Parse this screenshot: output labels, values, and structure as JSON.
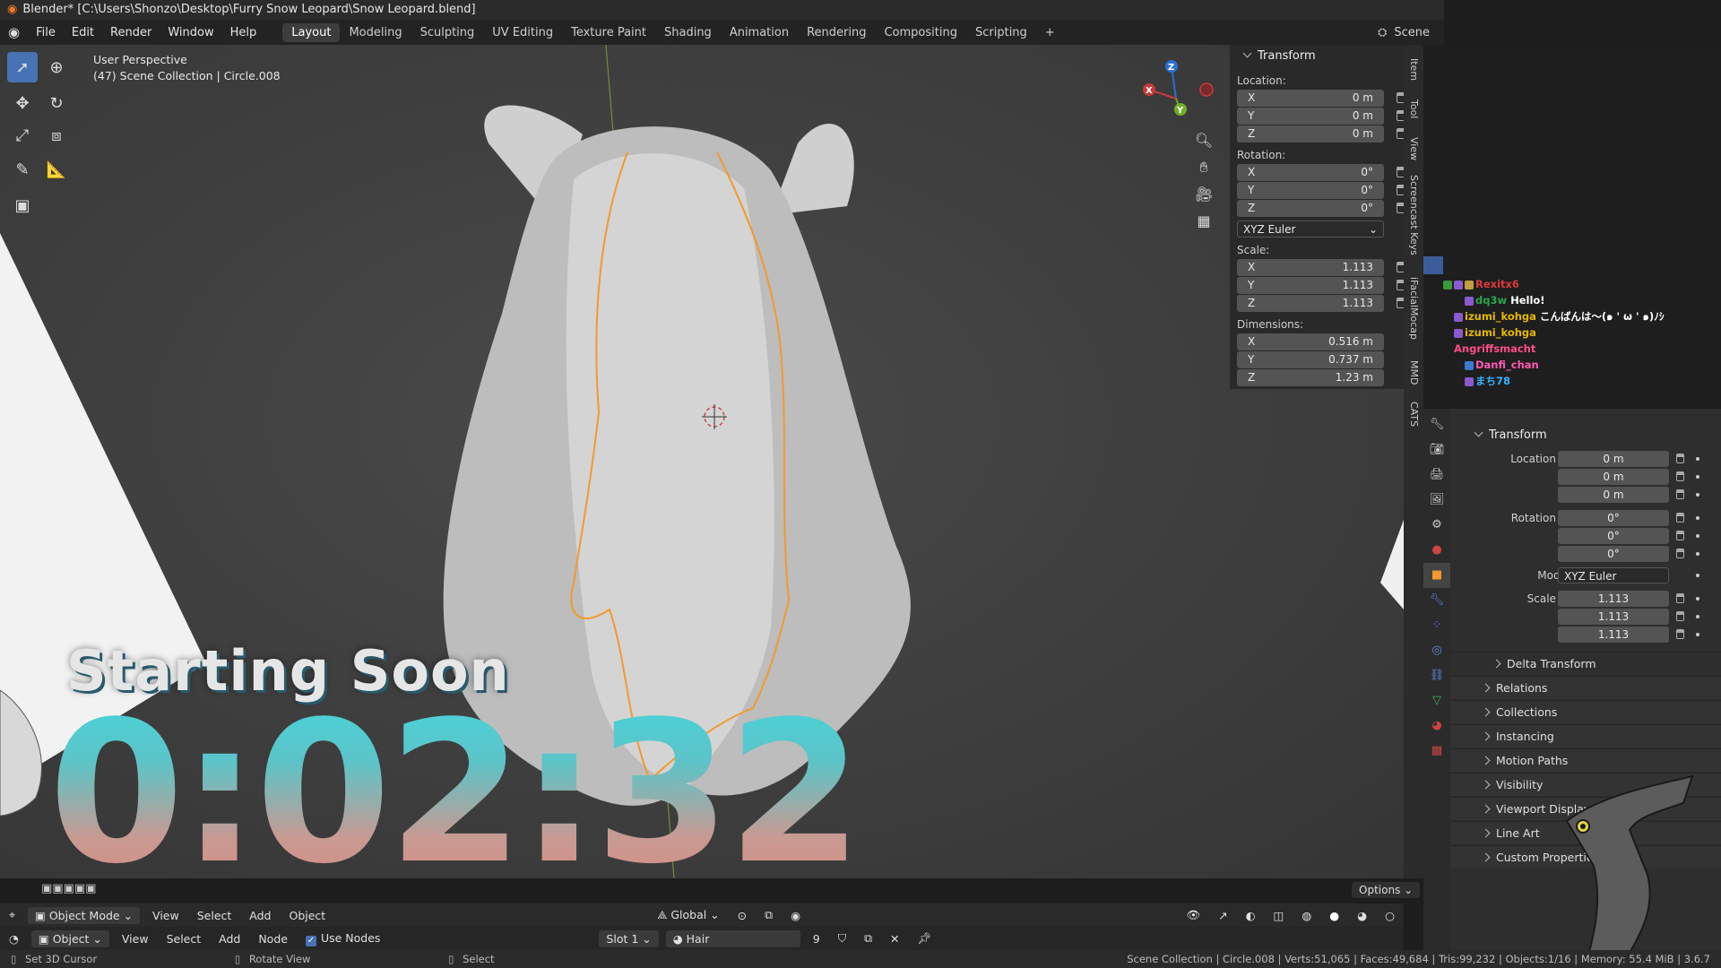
{
  "window": {
    "title": "Blender* [C:\\Users\\Shonzo\\Desktop\\Furry Snow Leopard\\Snow Leopard.blend]"
  },
  "menu": [
    "File",
    "Edit",
    "Render",
    "Window",
    "Help"
  ],
  "workspaces": {
    "active": "Layout",
    "tabs": [
      "Layout",
      "Modeling",
      "Sculpting",
      "UV Editing",
      "Texture Paint",
      "Shading",
      "Animation",
      "Rendering",
      "Compositing",
      "Scripting"
    ],
    "add": "+"
  },
  "scene": {
    "name": "Scene"
  },
  "viewport": {
    "view_name": "User Perspective",
    "collection_info": "(47) Scene Collection | Circle.008",
    "gizmo": {
      "x": "X",
      "y": "Y",
      "z": "Z"
    }
  },
  "npanel": {
    "header": "Transform",
    "location_label": "Location:",
    "location": [
      {
        "k": "X",
        "v": "0 m"
      },
      {
        "k": "Y",
        "v": "0 m"
      },
      {
        "k": "Z",
        "v": "0 m"
      }
    ],
    "rotation_label": "Rotation:",
    "rotation": [
      {
        "k": "X",
        "v": "0°"
      },
      {
        "k": "Y",
        "v": "0°"
      },
      {
        "k": "Z",
        "v": "0°"
      }
    ],
    "rotation_mode": "XYZ Euler",
    "scale_label": "Scale:",
    "scale": [
      {
        "k": "X",
        "v": "1.113"
      },
      {
        "k": "Y",
        "v": "1.113"
      },
      {
        "k": "Z",
        "v": "1.113"
      }
    ],
    "dimensions_label": "Dimensions:",
    "dimensions": [
      {
        "k": "X",
        "v": "0.516 m"
      },
      {
        "k": "Y",
        "v": "0.737 m"
      },
      {
        "k": "Z",
        "v": "1.23 m"
      }
    ]
  },
  "side_tabs": [
    "Item",
    "Tool",
    "View",
    "Screencast Keys",
    "iFacialMocap",
    "MMD",
    "CATS"
  ],
  "chat": [
    {
      "user": "Rexitx6",
      "color": "#e03a3a",
      "msg": ""
    },
    {
      "user": "dq3w",
      "color": "#2aa84a",
      "msg": "Hello!"
    },
    {
      "user": "izumi_kohga",
      "color": "#e6b800",
      "msg": "こんばんは〜(๑ ' ω ' ๑)ﾉｼ"
    },
    {
      "user": "izumi_kohga",
      "color": "#e6b800",
      "msg": ""
    },
    {
      "user": "Angriffsmacht",
      "color": "#ff4d8a",
      "msg": ""
    },
    {
      "user": "Danfi_chan",
      "color": "#ff5ab0",
      "msg": ""
    },
    {
      "user": "まち78",
      "color": "#3ab0ff",
      "msg": ""
    }
  ],
  "properties": {
    "header": "Transform",
    "location": [
      {
        "k": "Location X",
        "v": "0 m"
      },
      {
        "k": "Y",
        "v": "0 m"
      },
      {
        "k": "Z",
        "v": "0 m"
      }
    ],
    "rotation": [
      {
        "k": "Rotation X",
        "v": "0°"
      },
      {
        "k": "Y",
        "v": "0°"
      },
      {
        "k": "Z",
        "v": "0°"
      }
    ],
    "mode_label": "Mode",
    "mode_value": "XYZ Euler",
    "scale": [
      {
        "k": "Scale X",
        "v": "1.113"
      },
      {
        "k": "Y",
        "v": "1.113"
      },
      {
        "k": "Z",
        "v": "1.113"
      }
    ],
    "delta": "Delta Transform",
    "sections": [
      "Relations",
      "Collections",
      "Instancing",
      "Motion Paths",
      "Visibility",
      "Viewport Display",
      "Line Art",
      "Custom Properties"
    ]
  },
  "overlay": {
    "title": "Starting Soon",
    "timer": "0:02:32"
  },
  "viewport_header": {
    "options": "Options",
    "mode": "Object Mode",
    "menus": [
      "View",
      "Select",
      "Add",
      "Object"
    ],
    "orientation": "Global"
  },
  "shader_header": {
    "type": "Object",
    "menus": [
      "View",
      "Select",
      "Add",
      "Node"
    ],
    "use_nodes": "Use Nodes",
    "slot": "Slot 1",
    "material": "Hair",
    "users": "9"
  },
  "status": {
    "left1": "Set 3D Cursor",
    "left2": "Rotate View",
    "left3": "Select",
    "right": "Scene Collection | Circle.008 | Verts:51,065 | Faces:49,684 | Tris:99,232 | Objects:1/16 | Memory: 55.4 MiB | 3.6.7"
  },
  "colors": {
    "accent": "#4772b3",
    "selection_outline": "#f29a2e",
    "timer_top": "#45d6dc",
    "timer_bottom": "#dc8a82"
  }
}
